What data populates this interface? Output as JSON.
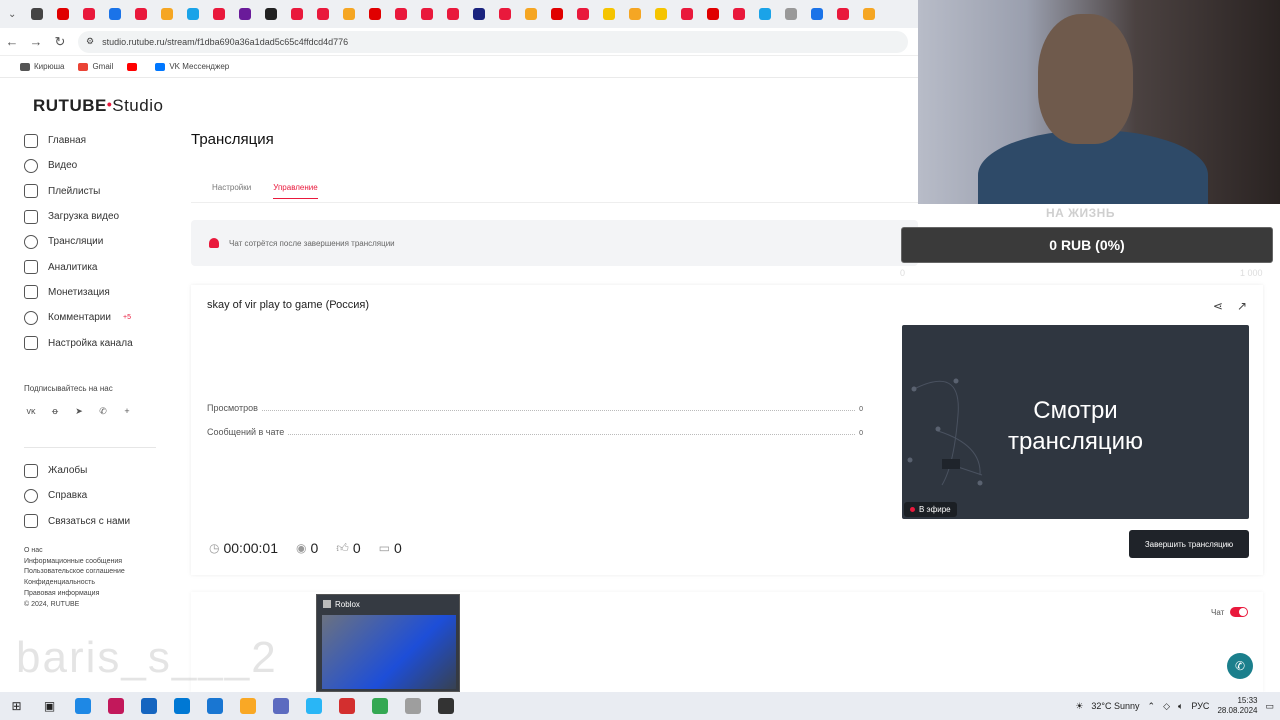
{
  "browser": {
    "url": "studio.rutube.ru/stream/f1dba690a36a1dad5c65c4ffdcd4d776",
    "bookmarks": [
      {
        "label": "Кирюша",
        "color": "#555555"
      },
      {
        "label": "Gmail",
        "color": "#ea4335"
      },
      {
        "label": "",
        "color": "#ff0000"
      },
      {
        "label": "VK Мессенджер",
        "color": "#0077ff"
      }
    ],
    "tab_colors": [
      "#444444",
      "#e00000",
      "#e9193c",
      "#1a73e8",
      "#e9193c",
      "#f5a623",
      "#1aa3e8",
      "#e9193c",
      "#6a1b9a",
      "#222222",
      "#e9193c",
      "#e9193c",
      "#f5a623",
      "#e00000",
      "#e9193c",
      "#e9193c",
      "#e9193c",
      "#1a237e",
      "#e9193c",
      "#f5a623",
      "#e00000",
      "#e9193c",
      "#f5c400",
      "#f5a623",
      "#f5c400",
      "#e9193c",
      "#e00000",
      "#e9193c",
      "#1aa3e8",
      "#999999",
      "#1a73e8",
      "#e9193c",
      "#f5a623"
    ]
  },
  "logo": {
    "main": "RUTUBE",
    "sub": "Studio"
  },
  "sidebar": {
    "items": [
      {
        "label": "Главная",
        "icon": "home-icon"
      },
      {
        "label": "Видео",
        "icon": "video-icon"
      },
      {
        "label": "Плейлисты",
        "icon": "playlist-icon"
      },
      {
        "label": "Загрузка видео",
        "icon": "upload-icon"
      },
      {
        "label": "Трансляции",
        "icon": "broadcast-icon"
      },
      {
        "label": "Аналитика",
        "icon": "analytics-icon"
      },
      {
        "label": "Монетизация",
        "icon": "money-icon"
      },
      {
        "label": "Комментарии",
        "icon": "comments-icon",
        "badge": "+5"
      },
      {
        "label": "Настройка канала",
        "icon": "settings-icon"
      }
    ],
    "subscribe_label": "Подписывайтесь на нас",
    "socials": [
      "vk-icon",
      "ok-icon",
      "telegram-icon",
      "viber-icon",
      "plus-icon"
    ],
    "secondary": [
      {
        "label": "Жалобы",
        "icon": "flag-icon"
      },
      {
        "label": "Справка",
        "icon": "help-icon"
      },
      {
        "label": "Связаться с нами",
        "icon": "mail-icon"
      }
    ],
    "footer": [
      "О нас",
      "Информационные сообщения",
      "Пользовательское соглашение",
      "Конфиденциальность",
      "Правовая информация",
      "© 2024, RUTUBE"
    ]
  },
  "main": {
    "title": "Трансляция",
    "tabs": [
      {
        "label": "Настройки",
        "active": false
      },
      {
        "label": "Управление",
        "active": true
      }
    ],
    "notice": "Чат сотрётся после завершения трансляции",
    "stream_name": "skay of vir play to game (Россия)",
    "stats": [
      {
        "label": "Просмотров",
        "value": "0"
      },
      {
        "label": "Сообщений в чате",
        "value": "0"
      }
    ],
    "duration": "00:00:01",
    "viewers": "0",
    "likes": "0",
    "dislikes": "0",
    "preview_text_1": "Смотри",
    "preview_text_2": "трансляцию",
    "live_label": "В эфире",
    "end_button": "Завершить трансляцию",
    "chat_label": "Чат"
  },
  "overlay": {
    "goal_label": "НА ЖИЗНЬ",
    "goal_value": "0 RUB (0%)",
    "goal_min": "0",
    "goal_max": "1 000",
    "name_text": "baris_s___2",
    "thumb_title": "Roblox"
  },
  "taskbar": {
    "apps": [
      "#1e88e5",
      "#c2185b",
      "#1565c0",
      "#0078d4",
      "#1976d2",
      "#f9a825",
      "#5c6bc0",
      "#29b6f6",
      "#d32f2f",
      "#34a853",
      "#9e9e9e",
      "#333333"
    ],
    "weather": "32°C  Sunny",
    "lang": "РУС",
    "time": "15:33",
    "date": "28.08.2024"
  }
}
